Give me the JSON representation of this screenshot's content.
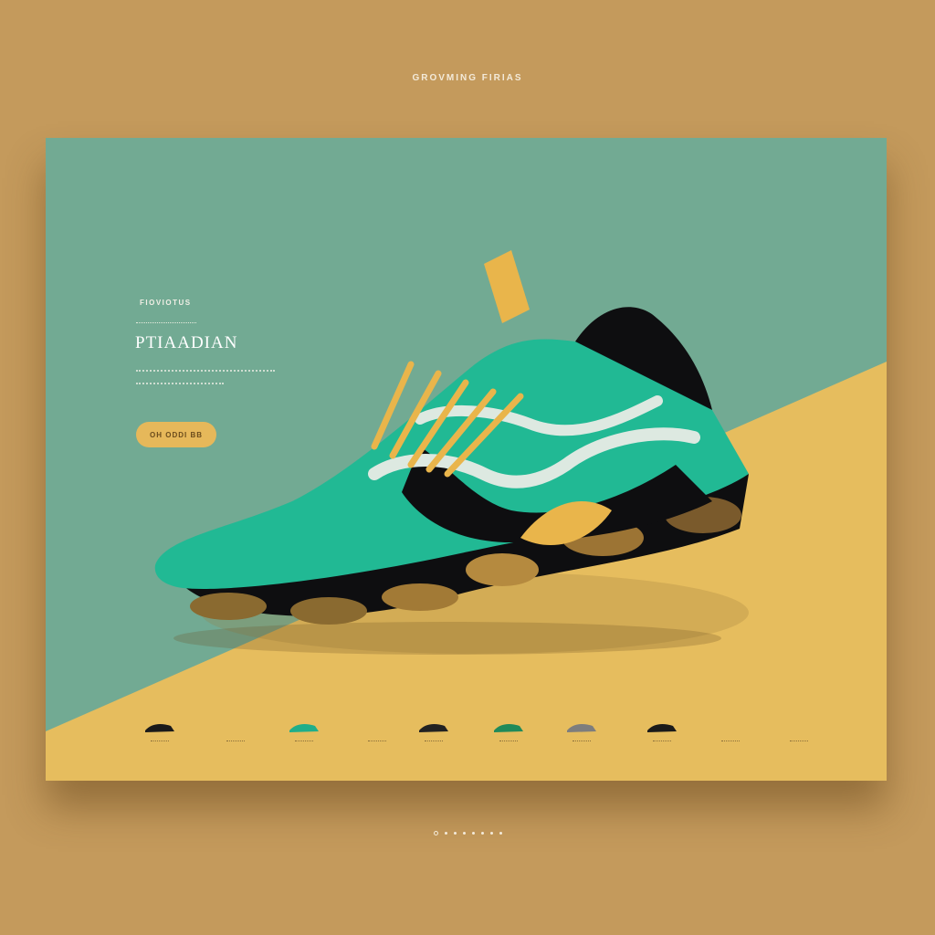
{
  "header": {
    "site_title": "GROVMING FIRIAS"
  },
  "hero": {
    "eyebrow": "FIOVIOTUS",
    "headline": "PTIAADIAN",
    "cta_label": "OH ODDI BB"
  },
  "colors": {
    "page_bg": "#c49a5c",
    "card_teal": "#72aa93",
    "card_gold": "#e6bd5e",
    "shoe_upper": "#21b994",
    "shoe_sole": "#0e0e10",
    "accent_gold": "#e6b85a"
  },
  "thumbnails": [
    {
      "name": "black-gold-shoe",
      "color": "#1a1a1a"
    },
    {
      "name": "teal-shoe",
      "color": "#1fae8a"
    },
    {
      "name": "black-shoe",
      "color": "#222222"
    },
    {
      "name": "green-shoe",
      "color": "#1f8a5a"
    },
    {
      "name": "grey-shoe",
      "color": "#7d7d7d"
    },
    {
      "name": "dark-shoe",
      "color": "#1a1a1a"
    }
  ],
  "pager": {
    "count": 8,
    "active_index": 0
  }
}
